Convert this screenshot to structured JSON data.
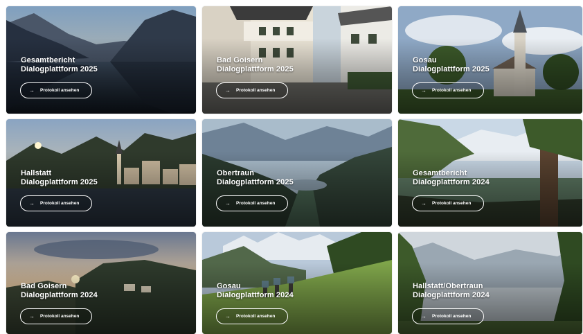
{
  "cards": [
    {
      "place": "Gesamtbericht",
      "subtitle": "Dialogplattform 2025",
      "button": "Protokoll ansehen",
      "arrow_icon": "→"
    },
    {
      "place": "Bad Goisern",
      "subtitle": "Dialogplattform 2025",
      "button": "Protokoll ansehen",
      "arrow_icon": "→"
    },
    {
      "place": "Gosau",
      "subtitle": "Dialogplattform 2025",
      "button": "Protokoll ansehen",
      "arrow_icon": "→"
    },
    {
      "place": "Hallstatt",
      "subtitle": "Dialogplattform 2025",
      "button": "Protokoll ansehen",
      "arrow_icon": "→"
    },
    {
      "place": "Obertraun",
      "subtitle": "Dialogplattform 2025",
      "button": "Protokoll ansehen",
      "arrow_icon": "→"
    },
    {
      "place": "Gesamtbericht",
      "subtitle": "Dialogplattform 2024",
      "button": "Protokoll ansehen",
      "arrow_icon": "→"
    },
    {
      "place": "Bad Goisern",
      "subtitle": "Dialogplattform 2024",
      "button": "Protokoll ansehen",
      "arrow_icon": "→"
    },
    {
      "place": "Gosau",
      "subtitle": "Dialogplattform 2024",
      "button": "Protokoll ansehen",
      "arrow_icon": "→"
    },
    {
      "place": "Hallstatt/Obertraun",
      "subtitle": "Dialogplattform 2024",
      "button": "Protokoll ansehen",
      "arrow_icon": "→"
    }
  ]
}
